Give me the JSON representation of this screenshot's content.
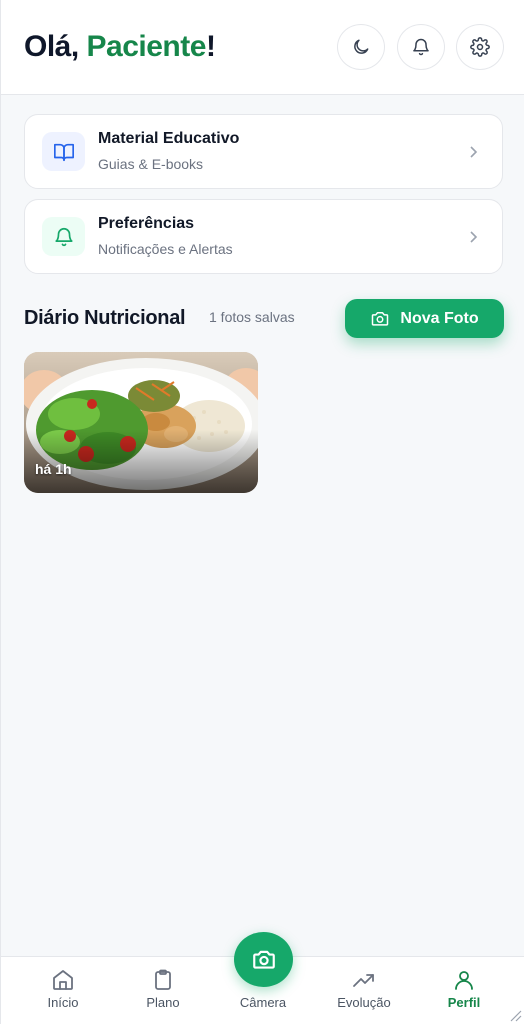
{
  "header": {
    "greeting_prefix": "Olá, ",
    "greeting_name": "Paciente",
    "greeting_suffix": "!",
    "icons": [
      "moon-icon",
      "bell-icon",
      "gear-icon"
    ]
  },
  "menu": [
    {
      "title": "Material Educativo",
      "subtitle": "Guias & E-books",
      "icon": "book-icon"
    },
    {
      "title": "Preferências",
      "subtitle": "Notificações e Alertas",
      "icon": "bell-icon"
    }
  ],
  "diary": {
    "title": "Diário Nutricional",
    "count": "1 fotos salvas",
    "new_photo_label": "Nova Foto",
    "photos": [
      {
        "time": "há 1h"
      }
    ]
  },
  "bottom_nav": {
    "items": [
      {
        "label": "Início",
        "icon": "home-icon"
      },
      {
        "label": "Plano",
        "icon": "clipboard-icon"
      },
      {
        "label": "Câmera",
        "icon": "camera-icon"
      },
      {
        "label": "Evolução",
        "icon": "trending-up-icon"
      },
      {
        "label": "Perfil",
        "icon": "user-icon"
      }
    ],
    "active": "Perfil"
  },
  "colors": {
    "brand_green": "#16a86a",
    "brand_green_dark": "#16864a",
    "book_icon_bg": "#eef2ff",
    "book_icon": "#2563eb",
    "bell_icon_bg": "#ecfdf5",
    "bell_icon": "#16a86a"
  }
}
